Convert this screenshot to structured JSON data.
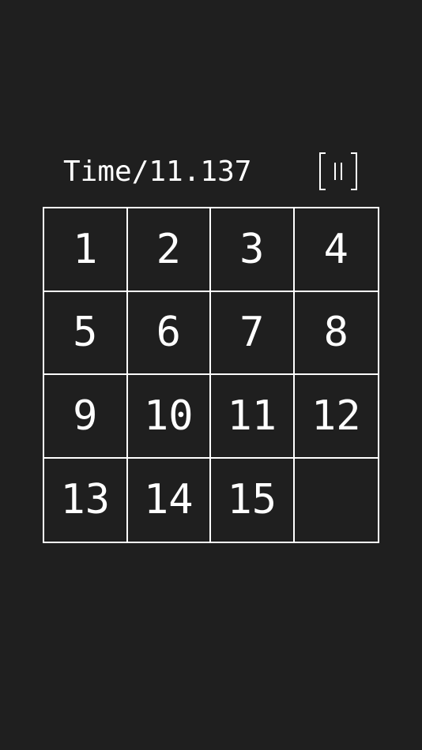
{
  "timer": {
    "label": "Time/",
    "value": "11.137"
  },
  "pause_button": {
    "icon": "pause-icon"
  },
  "board": {
    "tiles": [
      "1",
      "2",
      "3",
      "4",
      "5",
      "6",
      "7",
      "8",
      "9",
      "10",
      "11",
      "12",
      "13",
      "14",
      "15",
      ""
    ]
  },
  "colors": {
    "background": "#1f1f1f",
    "foreground": "#ffffff"
  }
}
